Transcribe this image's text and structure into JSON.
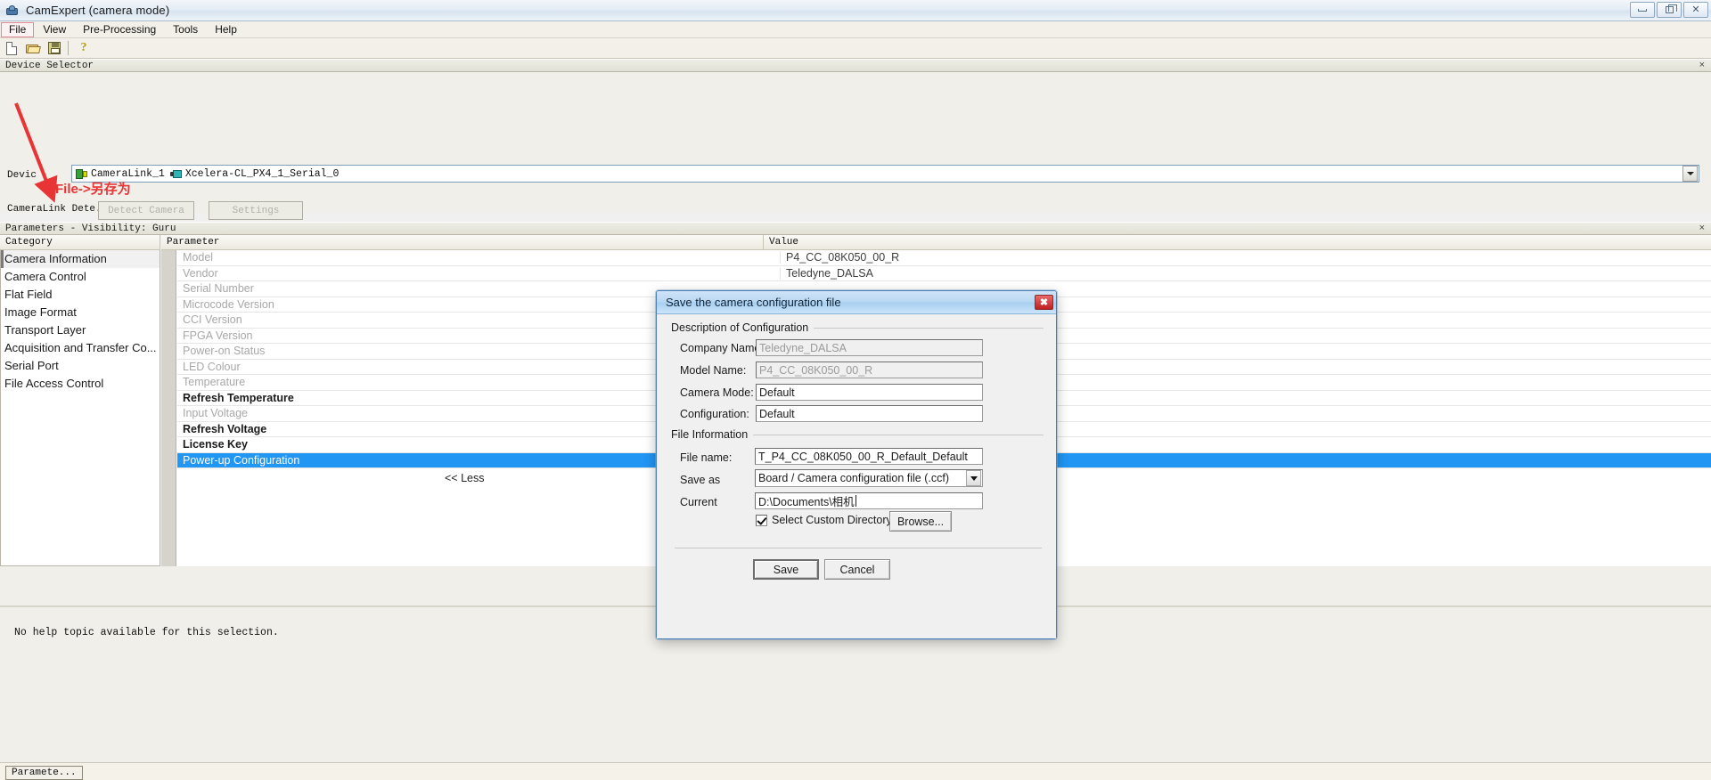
{
  "window": {
    "title": "CamExpert (camera mode)",
    "icon": "camera-icon",
    "buttons": {
      "minimize": "minimize-icon",
      "maximize": "maximize-icon",
      "close": "close-icon"
    }
  },
  "menubar": {
    "items": [
      {
        "label": "File",
        "active": true
      },
      {
        "label": "View",
        "active": false
      },
      {
        "label": "Pre-Processing",
        "active": false
      },
      {
        "label": "Tools",
        "active": false
      },
      {
        "label": "Help",
        "active": false
      }
    ]
  },
  "toolbar": {
    "buttons": [
      {
        "name": "new-file-icon"
      },
      {
        "name": "open-file-icon"
      },
      {
        "name": "save-file-icon"
      },
      {
        "name": "help-icon",
        "glyph": "?"
      }
    ]
  },
  "device_selector": {
    "panel_title": "Device Selector",
    "close_glyph": "×",
    "device_label": "Devic",
    "device_chips": [
      {
        "icon": "board-icon",
        "label": "CameraLink_1"
      },
      {
        "icon": "camera-icon",
        "label": "Xcelera-CL_PX4_1_Serial_0"
      }
    ],
    "detect_label": "CameraLink Dete...",
    "detect_button": "Detect Camera",
    "settings_button": "Settings"
  },
  "annotation": {
    "text": "File->另存为",
    "color": "#e83434"
  },
  "parameters": {
    "panel_title": "Parameters - Visibility: Guru",
    "close_glyph": "×",
    "columns": {
      "category": "Category",
      "parameter": "Parameter",
      "value": "Value"
    },
    "categories": [
      {
        "label": "Camera Information",
        "selected": true
      },
      {
        "label": "Camera Control",
        "selected": false
      },
      {
        "label": "Flat Field",
        "selected": false
      },
      {
        "label": "Image Format",
        "selected": false
      },
      {
        "label": "Transport Layer",
        "selected": false
      },
      {
        "label": "Acquisition and Transfer Co...",
        "selected": false
      },
      {
        "label": "Serial Port",
        "selected": false
      },
      {
        "label": "File Access Control",
        "selected": false
      }
    ],
    "rows": [
      {
        "name": "Model",
        "value": "P4_CC_08K050_00_R",
        "state": "dim",
        "selected": false
      },
      {
        "name": "Vendor",
        "value": "Teledyne_DALSA",
        "state": "dim",
        "selected": false
      },
      {
        "name": "Serial Number",
        "value": "",
        "state": "dim",
        "selected": false
      },
      {
        "name": "Microcode Version",
        "value": "",
        "state": "dim",
        "selected": false
      },
      {
        "name": "CCI Version",
        "value": "",
        "state": "dim",
        "selected": false
      },
      {
        "name": "FPGA Version",
        "value": "",
        "state": "dim",
        "selected": false
      },
      {
        "name": "Power-on Status",
        "value": "",
        "state": "dim",
        "selected": false
      },
      {
        "name": "LED Colour",
        "value": "",
        "state": "dim",
        "selected": false
      },
      {
        "name": "Temperature",
        "value": "",
        "state": "dim",
        "selected": false
      },
      {
        "name": "Refresh Temperature",
        "value": "",
        "state": "act",
        "selected": false
      },
      {
        "name": "Input Voltage",
        "value": "",
        "state": "dim",
        "selected": false
      },
      {
        "name": "Refresh Voltage",
        "value": "",
        "state": "act",
        "selected": false
      },
      {
        "name": "License Key",
        "value": "",
        "state": "act",
        "selected": false
      },
      {
        "name": "Power-up Configuration",
        "value": "",
        "state": "act",
        "selected": true
      }
    ],
    "less_link": "<< Less"
  },
  "help": {
    "text": "No help topic available for this selection."
  },
  "statusbar": {
    "tab": "Paramete..."
  },
  "dialog": {
    "title": "Save the camera configuration file",
    "close_glyph": "✖",
    "group_description": "Description of Configuration",
    "group_file": "File Information",
    "fields": {
      "company_label": "Company Name:",
      "company_value": "Teledyne_DALSA",
      "model_label": "Model Name:",
      "model_value": "P4_CC_08K050_00_R",
      "camera_mode_label": "Camera Mode:",
      "camera_mode_value": "Default",
      "configuration_label": "Configuration:",
      "configuration_value": "Default",
      "file_name_label": "File name:",
      "file_name_value": "T_P4_CC_08K050_00_R_Default_Default",
      "save_as_label": "Save as",
      "save_as_value": "Board / Camera configuration file (.ccf)",
      "current_label": "Current",
      "current_value": "D:\\Documents\\相机",
      "custom_dir_label": "Select Custom Directory",
      "custom_dir_checked": true,
      "browse_button": "Browse..."
    },
    "buttons": {
      "save": "Save",
      "cancel": "Cancel"
    }
  }
}
